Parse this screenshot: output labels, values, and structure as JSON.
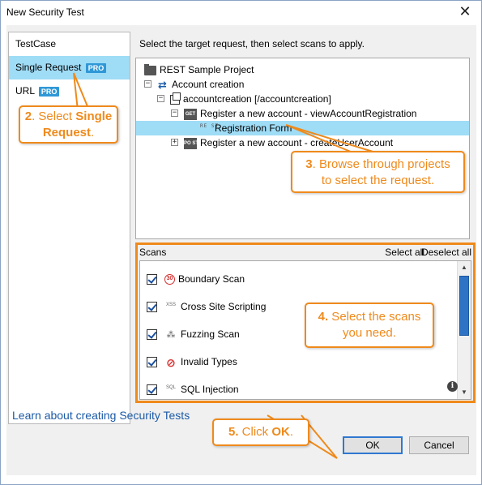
{
  "window": {
    "title": "New Security Test",
    "close_glyph": "✕"
  },
  "sidebar": {
    "items": [
      {
        "label": "TestCase",
        "badge": ""
      },
      {
        "label": "Single Request",
        "badge": "PRO"
      },
      {
        "label": "URL",
        "badge": "PRO"
      }
    ]
  },
  "main": {
    "instruction": "Select the target request, then select scans to apply.",
    "tree": [
      {
        "label": "REST Sample Project",
        "icon": "folder-icon"
      },
      {
        "label": "Account creation",
        "icon": "exchange-icon"
      },
      {
        "label": "accountcreation [/accountcreation]",
        "icon": "resource-icon"
      },
      {
        "label": "Register a new account - viewAccountRegistration",
        "icon": "get-method-icon",
        "badge": "GET"
      },
      {
        "label": "Registration Form",
        "icon": "rest-request-icon",
        "badge": "RE ST"
      },
      {
        "label": "Register a new account - createUserAccount",
        "icon": "post-method-icon",
        "badge": "PO ST"
      }
    ],
    "scans": {
      "title": "Scans",
      "select_all": "Select all",
      "deselect_all": "Deselect all",
      "items": [
        {
          "label": "Boundary Scan",
          "icon": "boundary-scan-icon",
          "checked": true
        },
        {
          "label": "Cross Site Scripting",
          "icon": "xss-icon",
          "checked": true
        },
        {
          "label": "Fuzzing Scan",
          "icon": "fuzzing-icon",
          "checked": true
        },
        {
          "label": "Invalid Types",
          "icon": "invalid-types-icon",
          "checked": true
        },
        {
          "label": "SQL Injection",
          "icon": "sql-icon",
          "checked": true
        }
      ]
    }
  },
  "footer": {
    "learn_link": "Learn about creating Security Tests",
    "ok": "OK",
    "cancel": "Cancel"
  },
  "callouts": {
    "c2": {
      "num": "2",
      "pre": ". Select ",
      "bold": "Single Request",
      "post": "."
    },
    "c3": {
      "num": "3",
      "text": ". Browse through projects to select the request."
    },
    "c4": {
      "num": "4.",
      "text": " Select the scans you need."
    },
    "c5": {
      "num": "5.",
      "pre": " Click ",
      "bold": "OK",
      "post": "."
    }
  },
  "colors": {
    "accent": "#ef8a1c",
    "selection": "#9fdcf6",
    "badge": "#2f98d6",
    "link": "#1c5aa6"
  }
}
